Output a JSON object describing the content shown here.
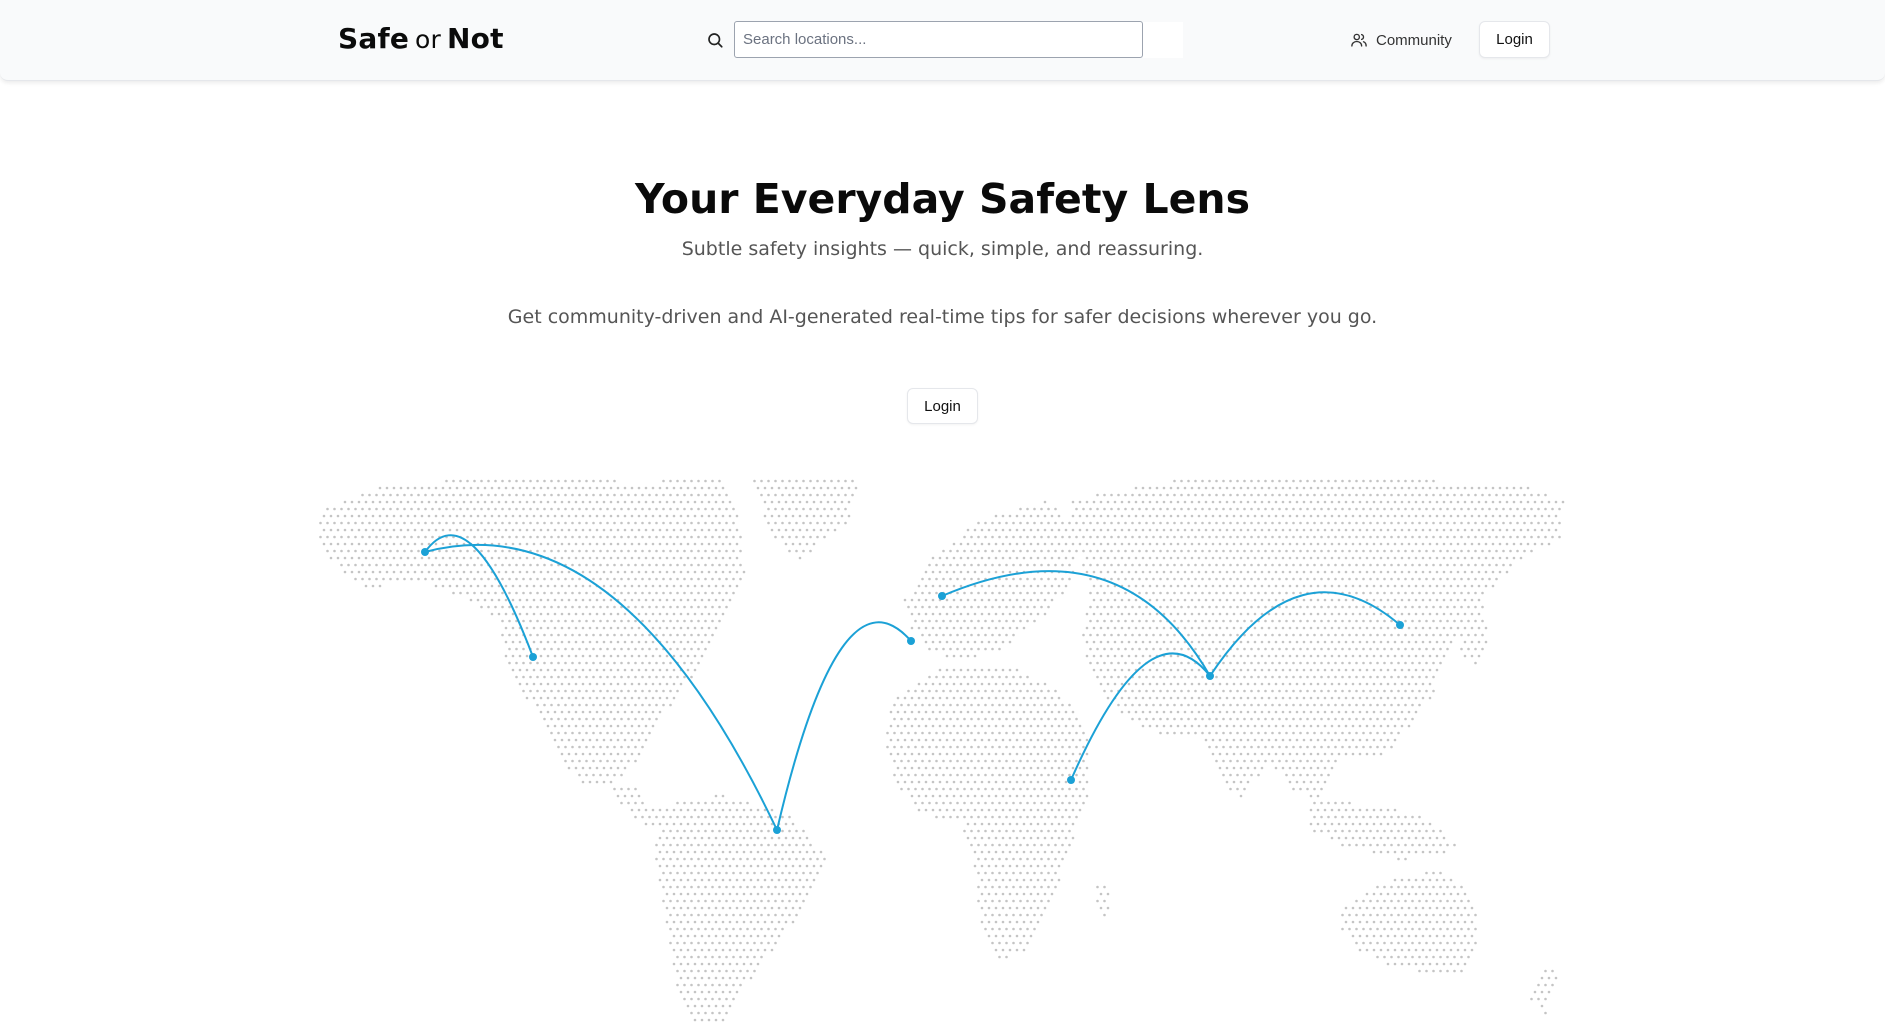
{
  "header": {
    "logo_bold_1": "Safe",
    "logo_mid": "or",
    "logo_bold_2": "Not",
    "search_placeholder": "Search locations...",
    "search_icon": "search-icon",
    "community_label": "Community",
    "community_icon": "users-icon",
    "login_label": "Login"
  },
  "hero": {
    "title": "Your Everyday Safety Lens",
    "subtitle": "Subtle safety insights — quick, simple, and reassuring.",
    "description": "Get community-driven and AI-generated real-time tips for safer decisions wherever you go.",
    "login_label": "Login"
  },
  "map": {
    "dot_color": "#c4c4c4",
    "route_color": "#1ba1d6",
    "connections": [
      {
        "from": "Alaska",
        "to": "Los Angeles"
      },
      {
        "from": "Alaska",
        "to": "Brasília"
      },
      {
        "from": "Brasília",
        "to": "Lisbon"
      },
      {
        "from": "London",
        "to": "New Delhi"
      },
      {
        "from": "Nairobi",
        "to": "New Delhi"
      },
      {
        "from": "New Delhi",
        "to": "Beijing"
      }
    ]
  },
  "colors": {
    "accent": "#1ba1d6",
    "text_primary": "#0a0a0a",
    "text_secondary": "#555555",
    "border": "#e5e7eb",
    "navbar_bg": "#f9fafb"
  }
}
